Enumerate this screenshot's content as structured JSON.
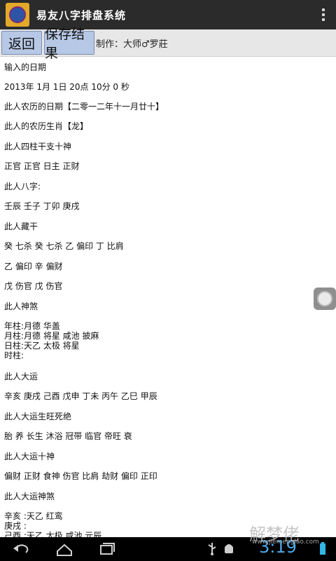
{
  "app": {
    "title": "易友八字排盘系统"
  },
  "toolbar": {
    "back_label": "返回",
    "save_label": "保存结果",
    "credit": "制作：大师♂罗莊"
  },
  "content": {
    "lines": [
      "输入的日期",
      "2013年 1月 1日 20点 10分 0 秒",
      "此人农历的日期【二零一二年十一月廿十】",
      "此人的农历生肖【龙】",
      "此人四柱干支十神",
      "正官 正官 日主 正财",
      "此人八字:",
      "壬辰 壬子 丁卯 庚戌",
      "此人藏干",
      "癸 七杀 癸 七杀 乙 偏印 丁 比肩",
      "乙 偏印 辛 偏财",
      "戊 伤官 戊 伤官",
      "此人神煞",
      "年柱:月德 华盖",
      "月柱:月德 将星 咸池 披麻",
      "日柱:天乙 太极 将星",
      "时柱:",
      "此人大运",
      "辛亥 庚戌 己酉 戊申 丁未 丙午 乙巳 甲辰",
      "此人大运生旺死绝",
      "胎 养 长生 沐浴 冠带 临官 帝旺 衰",
      "此人大运十神",
      "偏财 正财 食神 伤官 比肩 劫财 偏印 正印",
      "此人大运神煞",
      "辛亥 :天乙 红鸾",
      "庚戌 :",
      "己酉 :天乙 太极 咸池 元辰"
    ]
  },
  "status": {
    "time": "3:19"
  },
  "watermark": {
    "text": "解梦佬",
    "sub": "www.jiemenglao.com"
  },
  "colors": {
    "appbar": "#2b2b2b",
    "button": "#b7c8e6",
    "clock": "#4aa8e6"
  },
  "icons": [
    "app-logo-icon",
    "overflow-menu-icon",
    "floating-assistive-icon",
    "nav-back-icon",
    "nav-home-icon",
    "nav-recent-icon",
    "usb-icon",
    "android-debug-icon",
    "battery-icon"
  ]
}
